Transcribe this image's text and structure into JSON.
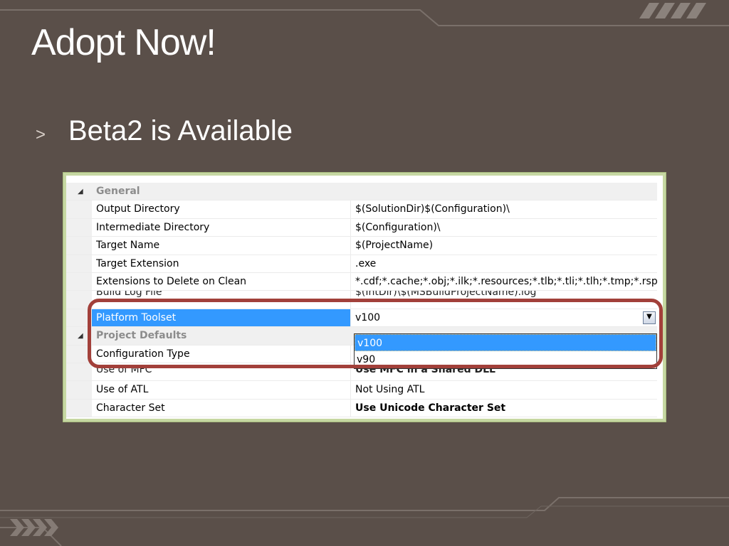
{
  "slide": {
    "title": "Adopt Now!",
    "bullet_marker": ">",
    "bullet_text": "Beta2 is Available"
  },
  "property_grid": {
    "rows": [
      {
        "type": "category",
        "name": "General",
        "value": ""
      },
      {
        "type": "property",
        "name": "Output Directory",
        "value": "$(SolutionDir)$(Configuration)\\"
      },
      {
        "type": "property",
        "name": "Intermediate Directory",
        "value": "$(Configuration)\\"
      },
      {
        "type": "property",
        "name": "Target Name",
        "value": "$(ProjectName)"
      },
      {
        "type": "property",
        "name": "Target Extension",
        "value": ".exe"
      },
      {
        "type": "property",
        "name": "Extensions to Delete on Clean",
        "value": "*.cdf;*.cache;*.obj;*.ilk;*.resources;*.tlb;*.tli;*.tlh;*.tmp;*.rsp;*"
      },
      {
        "type": "property",
        "name": "Build Log File",
        "value": "$(IntDir)\\$(MSBuildProjectName).log"
      },
      {
        "type": "property",
        "name": "Platform Toolset",
        "value": "v100",
        "selected": true
      },
      {
        "type": "category",
        "name": "Project Defaults",
        "value": ""
      },
      {
        "type": "property",
        "name": "Configuration Type",
        "value": ""
      },
      {
        "type": "property",
        "name": "Use of MFC",
        "value": "Use MFC in a Shared DLL",
        "bold": true
      },
      {
        "type": "property",
        "name": "Use of ATL",
        "value": "Not Using ATL"
      },
      {
        "type": "property",
        "name": "Character Set",
        "value": "Use Unicode Character Set",
        "bold": true
      }
    ],
    "dropdown_options": [
      "v100",
      "v90"
    ],
    "dropdown_selected": "v100"
  },
  "icons": {
    "category_collapse": "triangle-expanded-icon",
    "dropdown_arrow": "chevron-down-icon"
  },
  "colors": {
    "slide_background": "#5a4f49",
    "frame": "#c6d8a2",
    "selection": "#3399ff",
    "highlight_outline": "#a2403a"
  }
}
